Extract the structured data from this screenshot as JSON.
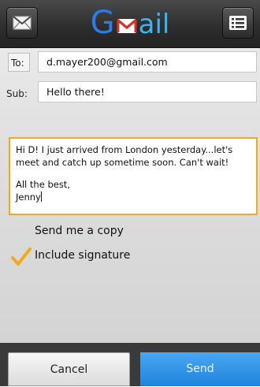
{
  "app": {
    "logo": {
      "g": "G",
      "rest": "ail"
    }
  },
  "header": {
    "left_icon": "mail-envelope-icon",
    "right_icon": "menu-list-icon"
  },
  "compose": {
    "to_label": "To:",
    "to_value": "d.mayer200@gmail.com",
    "subject_label": "Sub:",
    "subject_value": "Hello there!",
    "body_line1": "Hi D! I just arrived from London yesterday...let's meet and catch up sometime soon. Can't wait!",
    "body_line2": "All the best,",
    "body_line3": "Jenny"
  },
  "options": {
    "send_copy_label": "Send me a copy",
    "send_copy_checked": false,
    "include_signature_label": "Include signature",
    "include_signature_checked": true
  },
  "footer": {
    "cancel_label": "Cancel",
    "send_label": "Send"
  },
  "colors": {
    "accent_orange": "#f2a91d",
    "send_blue": "#2a8fe6",
    "logo_blue": "#2b7de9",
    "logo_light_blue": "#3db4f0",
    "logo_red": "#d93025"
  }
}
